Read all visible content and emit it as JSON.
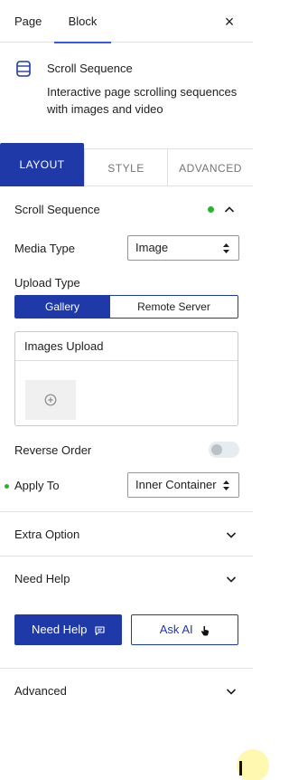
{
  "top_tabs": {
    "page": "Page",
    "block": "Block",
    "close": "×"
  },
  "block": {
    "title": "Scroll Sequence",
    "description": "Interactive page scrolling sequences with images and video",
    "icon": "scroll-sequence-icon"
  },
  "panel_tabs": {
    "layout": "LAYOUT",
    "style": "STYLE",
    "advanced": "ADVANCED"
  },
  "scroll_sequence": {
    "title": "Scroll Sequence",
    "media_type": {
      "label": "Media Type",
      "value": "Image"
    },
    "upload_type": {
      "label": "Upload Type",
      "options": [
        "Gallery",
        "Remote Server"
      ],
      "selected": "Gallery"
    },
    "images_upload": {
      "label": "Images Upload"
    },
    "reverse_order": {
      "label": "Reverse Order",
      "enabled": false
    },
    "apply_to": {
      "label": "Apply To",
      "value": "Inner Container"
    }
  },
  "sections": {
    "extra_option": "Extra Option",
    "need_help": "Need Help",
    "advanced": "Advanced"
  },
  "help_buttons": {
    "need_help": "Need Help",
    "ask_ai": "Ask AI"
  },
  "colors": {
    "accent": "#1f3aa8",
    "status_dot": "#2bb32b",
    "tab_underline": "#3858e9"
  }
}
